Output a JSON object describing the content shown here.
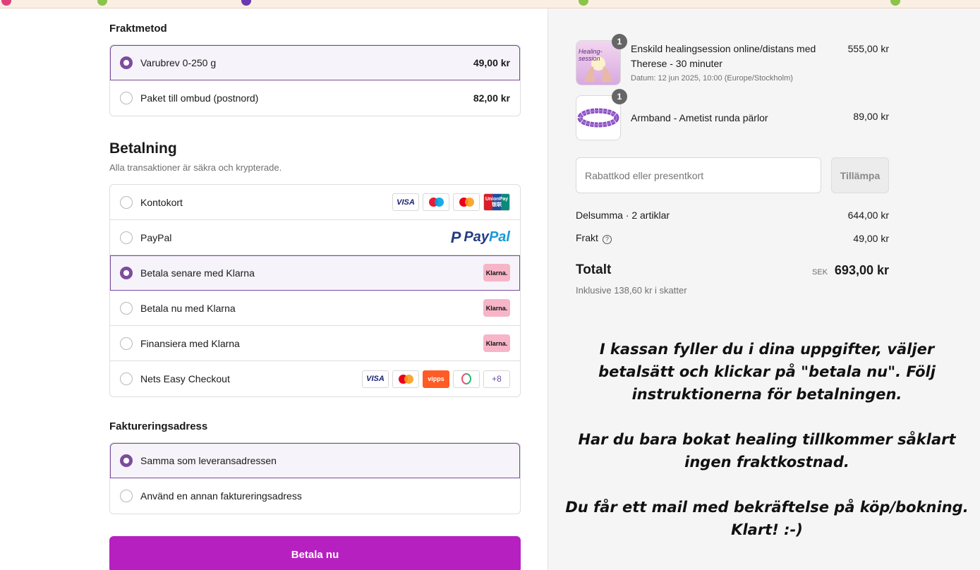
{
  "shipping": {
    "title": "Fraktmetod",
    "options": [
      {
        "label": "Varubrev 0-250 g",
        "price": "49,00 kr",
        "selected": true
      },
      {
        "label": "Paket till ombud (postnord)",
        "price": "82,00 kr",
        "selected": false
      }
    ]
  },
  "payment": {
    "title": "Betalning",
    "subtitle": "Alla transaktioner är säkra och krypterade.",
    "options": [
      {
        "label": "Kontokort",
        "selected": false,
        "logos": [
          "visa",
          "maestro",
          "mastercard",
          "unionpay"
        ]
      },
      {
        "label": "PayPal",
        "selected": false,
        "logos": [
          "paypal"
        ]
      },
      {
        "label": "Betala senare med Klarna",
        "selected": true,
        "logos": [
          "klarna"
        ]
      },
      {
        "label": "Betala nu med Klarna",
        "selected": false,
        "logos": [
          "klarna"
        ]
      },
      {
        "label": "Finansiera med Klarna",
        "selected": false,
        "logos": [
          "klarna"
        ]
      },
      {
        "label": "Nets Easy Checkout",
        "selected": false,
        "logos": [
          "visa",
          "mastercard",
          "vipps",
          "mobilepay",
          "more"
        ]
      }
    ],
    "logo_text": {
      "visa": "VISA",
      "unionpay": "UnionPay 银联",
      "paypal_pay": "Pay",
      "paypal_pal": "Pal",
      "klarna": "Klarna.",
      "vipps": "vipps",
      "more": "+8"
    }
  },
  "billing": {
    "title": "Faktureringsadress",
    "options": [
      {
        "label": "Samma som leveransadressen",
        "selected": true
      },
      {
        "label": "Använd en annan faktureringsadress",
        "selected": false
      }
    ]
  },
  "pay_button": "Betala nu",
  "cart": {
    "items": [
      {
        "name": "Enskild healingsession online/distans med Therese - 30 minuter",
        "meta": "Datum: 12 jun 2025, 10:00 (Europe/Stockholm)",
        "price": "555,00 kr",
        "qty": "1",
        "thumb_text": "Healing-session"
      },
      {
        "name": "Armband - Ametist runda pärlor",
        "price": "89,00 kr",
        "qty": "1"
      }
    ],
    "discount_placeholder": "Rabattkod eller presentkort",
    "apply_label": "Tillämpa",
    "subtotal_label": "Delsumma · 2 artiklar",
    "subtotal_value": "644,00 kr",
    "shipping_label": "Frakt",
    "shipping_value": "49,00 kr",
    "total_label": "Totalt",
    "total_currency": "SEK",
    "total_value": "693,00 kr",
    "tax_note": "Inklusive 138,60 kr i skatter"
  },
  "instructions": [
    "I kassan fyller du i dina uppgifter, väljer betalsätt och klickar på \"betala nu\". Följ instruktionerna för betalningen.",
    "Har du bara bokat healing tillkommer såklart ingen fraktkostnad.",
    "Du får ett mail med bekräftelse på köp/bokning. Klart! :-)"
  ],
  "colors": {
    "accent": "#7d4c9e",
    "pay_button": "#b620c0",
    "klarna_pink": "#f7b5c8",
    "right_bg": "#f5f5f5"
  }
}
